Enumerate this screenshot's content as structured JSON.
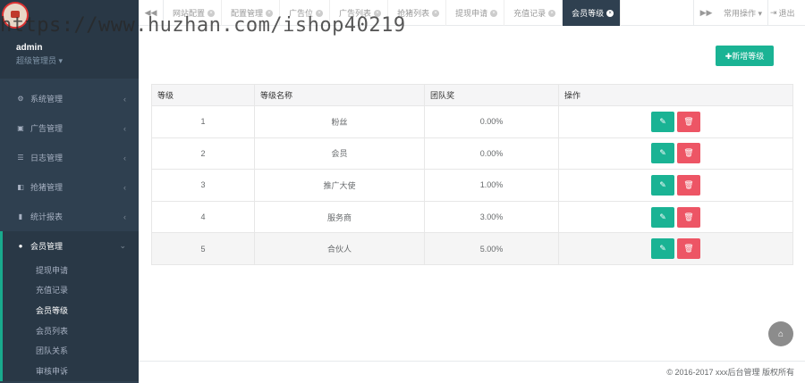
{
  "watermark": "https://www.huzhan.com/ishop40219",
  "profile": {
    "name": "admin",
    "role": "超级管理员 ▾"
  },
  "sidebar": {
    "items": [
      {
        "label": "系统管理",
        "icon": "gear-icon",
        "glyph": "⚙"
      },
      {
        "label": "广告管理",
        "icon": "image-icon",
        "glyph": "▣"
      },
      {
        "label": "日志管理",
        "icon": "list-icon",
        "glyph": "☰"
      },
      {
        "label": "抢猪管理",
        "icon": "book-icon",
        "glyph": "◧"
      },
      {
        "label": "统计报表",
        "icon": "bar-chart-icon",
        "glyph": "▮"
      }
    ],
    "active": {
      "label": "会员管理",
      "icon": "user-icon",
      "glyph": "●"
    },
    "subitems": [
      "提现申请",
      "充值记录",
      "会员等级",
      "会员列表",
      "团队关系",
      "审核申诉"
    ],
    "current_subitem": "会员等级"
  },
  "tabbar": {
    "prev_glyph": "◀◀",
    "next_glyph": "▶▶",
    "tabs": [
      "网站配置",
      "配置管理",
      "广告位",
      "广告列表",
      "抢猪列表",
      "提现申请",
      "充值记录",
      "会员等级"
    ],
    "active_tab": "会员等级",
    "ops_label": "常用操作 ▾",
    "logout_label": "退出"
  },
  "add_button": "✚新增等级",
  "table": {
    "headers": [
      "等级",
      "等级名称",
      "团队奖",
      "操作"
    ],
    "rows": [
      {
        "level": "1",
        "name": "粉丝",
        "bonus": "0.00%"
      },
      {
        "level": "2",
        "name": "会员",
        "bonus": "0.00%"
      },
      {
        "level": "3",
        "name": "推广大使",
        "bonus": "1.00%"
      },
      {
        "level": "4",
        "name": "服务商",
        "bonus": "3.00%"
      },
      {
        "level": "5",
        "name": "合伙人",
        "bonus": "5.00%"
      }
    ]
  },
  "footer": "© 2016-2017 xxx后台管理 版权所有",
  "colors": {
    "sidebar": "#2f4050",
    "accent": "#1ab394",
    "danger": "#ed5565"
  }
}
